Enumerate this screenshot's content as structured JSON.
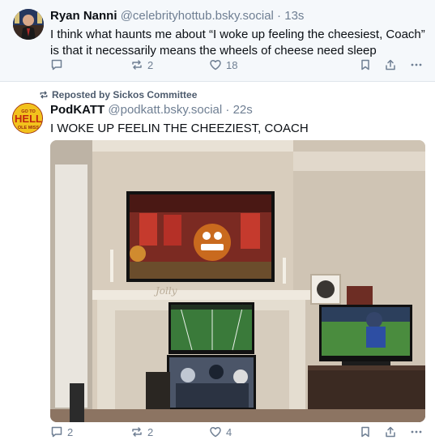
{
  "posts": [
    {
      "display_name": "Ryan Nanni",
      "handle": "@celebrityhottub.bsky.social",
      "separator": " · ",
      "time": "13s",
      "text": "I think what haunts me about “I woke up feeling the cheesiest, Coach” is that it necessarily means the wheels of cheese need sleep",
      "actions": {
        "reply_count": "",
        "repost_count": "2",
        "like_count": "18"
      }
    },
    {
      "repost_label": "Reposted by Sickos Committee",
      "display_name": "PodKATT",
      "handle": "@podkatt.bsky.social",
      "separator": " · ",
      "time": "22s",
      "avatar_text": {
        "top": "GO TO",
        "middle": "HELL",
        "bottom": "OLE MISS"
      },
      "text": "I WOKE UP FEELIN THE CHEEZIEST, COACH",
      "image": {
        "alt": "Living room with a large wall TV above a fireplace showing a cartoon locker room, and three smaller TVs showing football games"
      },
      "actions": {
        "reply_count": "2",
        "repost_count": "2",
        "like_count": "4"
      }
    }
  ],
  "colors": {
    "muted": "#6f7f93",
    "highlight_bg": "#f5f8fb",
    "border": "#dfe5ec"
  },
  "icons": [
    "reply-icon",
    "repost-icon",
    "like-icon",
    "bookmark-icon",
    "share-icon",
    "more-icon"
  ]
}
